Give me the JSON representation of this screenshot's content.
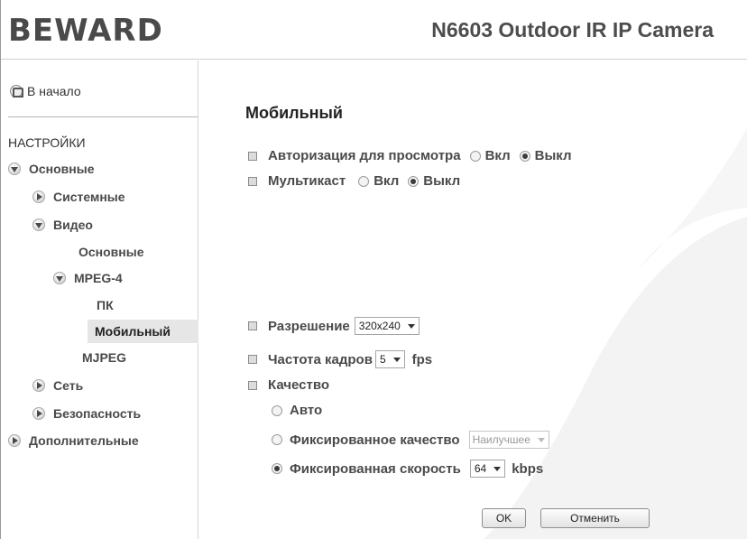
{
  "header": {
    "logo": "BEWARD",
    "model": "N6603 Outdoor IR IP Camera"
  },
  "sidebar": {
    "home": "В начало",
    "section": "НАСТРОЙКИ",
    "items": [
      {
        "label": "Основные"
      },
      {
        "label": "Системные"
      },
      {
        "label": "Видео"
      },
      {
        "label": "Основные"
      },
      {
        "label": "MPEG-4"
      },
      {
        "label": "ПК"
      },
      {
        "label": "Мобильный"
      },
      {
        "label": "MJPEG"
      },
      {
        "label": "Сеть"
      },
      {
        "label": "Безопасность"
      },
      {
        "label": "Дополнительные"
      }
    ]
  },
  "page": {
    "title": "Мобильный",
    "auth_label": "Авторизация для просмотра",
    "multicast_label": "Мультикаст",
    "on": "Вкл",
    "off": "Выкл",
    "resolution_label": "Разрешение",
    "resolution_value": "320x240",
    "framerate_label": "Частота кадров",
    "framerate_value": "5",
    "fps": "fps",
    "quality_label": "Качество",
    "auto": "Авто",
    "fixed_quality": "Фиксированное качество",
    "fixed_quality_value": "Наилучшее",
    "fixed_rate": "Фиксированная скорость",
    "fixed_rate_value": "64",
    "kbps": "kbps",
    "ok": "OK",
    "cancel": "Отменить"
  },
  "colors": {
    "text": "#4a4a4a",
    "watermark": "#f3f3f3",
    "active_bg": "#e6e6e6"
  }
}
